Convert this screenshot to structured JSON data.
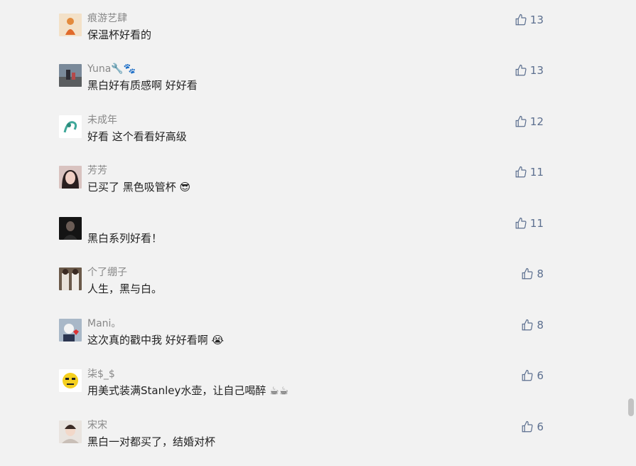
{
  "comments": [
    {
      "user": "痕游艺肆",
      "text": "保温杯好看的",
      "likes": "13",
      "avatar": "avatar-orange-figure"
    },
    {
      "user": "Yuna🔧🐾",
      "text": "黑白好有质感啊 好好看",
      "likes": "13",
      "avatar": "avatar-street-photo"
    },
    {
      "user": "未成年",
      "text": "好看 这个看看好高级",
      "likes": "12",
      "avatar": "avatar-green-doodle"
    },
    {
      "user": "芳芳",
      "text": "已买了 黑色吸管杯 😎",
      "likes": "11",
      "avatar": "avatar-woman-portrait"
    },
    {
      "user": "",
      "text": "黑白系列好看！",
      "likes": "11",
      "avatar": "avatar-dark-portrait"
    },
    {
      "user": "个了绷子",
      "text": "人生，黑与白。",
      "likes": "8",
      "avatar": "avatar-basketball-players"
    },
    {
      "user": "Mani。",
      "text": "这次真的戳中我 好好看啊 😭",
      "likes": "8",
      "avatar": "avatar-character-heart"
    },
    {
      "user": "柒$_$",
      "text": "用美式装满Stanley水壶，让自己喝醉 ☕☕",
      "likes": "6",
      "avatar": "avatar-yellow-emoji"
    },
    {
      "user": "宋宋",
      "text": "黑白一对都买了，结婚对杯",
      "likes": "6",
      "avatar": "avatar-girl-photo"
    }
  ],
  "icons": {
    "like": "thumbs-up-icon"
  },
  "colors": {
    "accent": "#5c6f8f",
    "background": "#f2f2f2",
    "name": "#888888",
    "text": "#222222"
  }
}
